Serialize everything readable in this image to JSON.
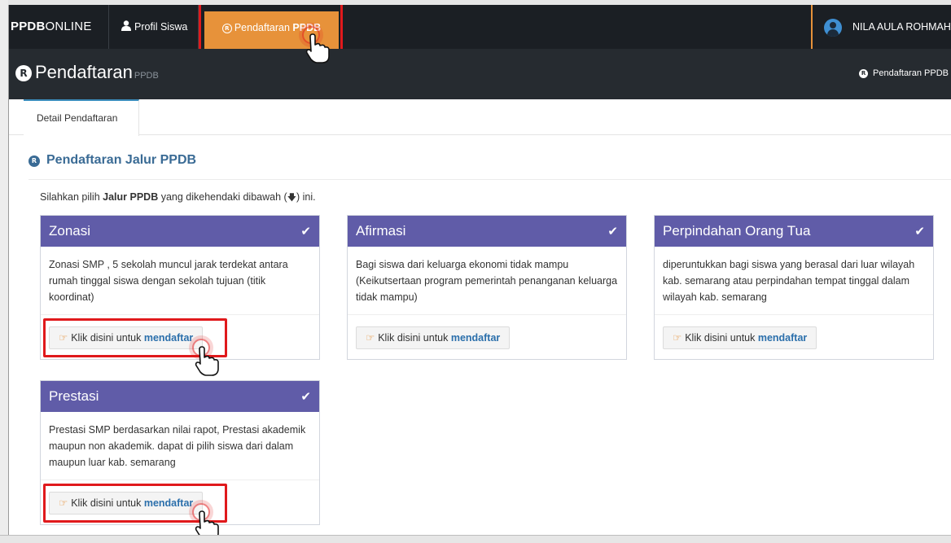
{
  "navbar": {
    "brand_bold": "PPDB",
    "brand_rest": "ONLINE",
    "profil_label": "Profil Siswa",
    "pendaftaran_label": "Pendaftaran",
    "pendaftaran_bold": "PPDB",
    "user_name": "NILA AULA ROHMAH"
  },
  "header": {
    "title": "Pendaftaran",
    "subtitle": "PPDB",
    "breadcrumb": "Pendaftaran PPDB",
    "registered_icon": "R"
  },
  "tabs": [
    {
      "label": "Detail Pendaftaran"
    }
  ],
  "section": {
    "title": "Pendaftaran Jalur PPDB",
    "intro_pre": "Silahkan pilih ",
    "intro_bold": "Jalur PPDB",
    "intro_mid": " yang dikehendaki dibawah (",
    "intro_arrow": "🡇",
    "intro_post": ") ini."
  },
  "cards": [
    {
      "title": "Zonasi",
      "description": "Zonasi SMP , 5 sekolah muncul jarak terdekat antara rumah tinggal siswa dengan sekolah tujuan (titik koordinat)",
      "button_prefix": "Klik disini untuk ",
      "button_bold": "mendaftar"
    },
    {
      "title": "Afirmasi",
      "description": "Bagi siswa dari keluarga ekonomi tidak mampu (Keikutsertaan program pemerintah penanganan keluarga tidak mampu)",
      "button_prefix": "Klik disini untuk ",
      "button_bold": "mendaftar"
    },
    {
      "title": "Perpindahan Orang Tua",
      "description": "diperuntukkan bagi siswa yang berasal dari luar wilayah kab. semarang atau perpindahan tempat tinggal dalam wilayah kab. semarang",
      "button_prefix": "Klik disini untuk ",
      "button_bold": "mendaftar"
    },
    {
      "title": "Prestasi",
      "description": "Prestasi SMP berdasarkan nilai rapot, Prestasi akademik maupun non akademik. dapat di pilih siswa dari dalam maupun luar kab. semarang",
      "button_prefix": "Klik disini untuk ",
      "button_bold": "mendaftar"
    }
  ],
  "colors": {
    "card_header": "#605ca8",
    "nav_active": "#e7923a",
    "highlight": "#e0191c",
    "link": "#2b6fab"
  }
}
